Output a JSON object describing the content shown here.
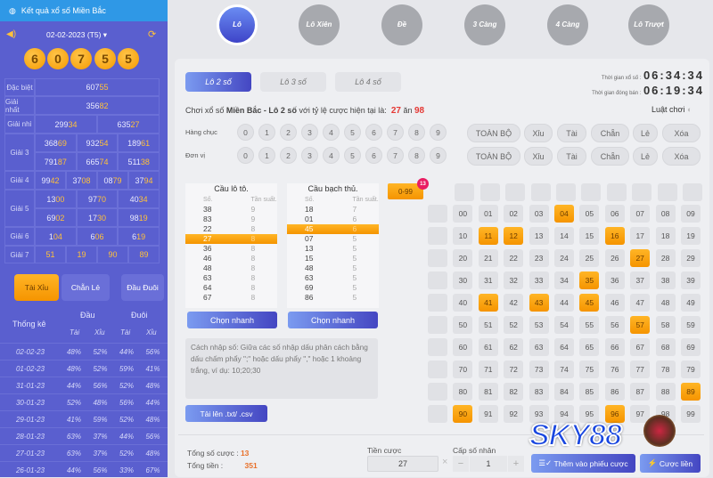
{
  "sidebar": {
    "title": "Kết quả xổ số Miền Bắc",
    "date": "02-02-2023 (T5)",
    "balls": [
      "6",
      "0",
      "7",
      "5",
      "5"
    ],
    "prizes": [
      {
        "label": "Đặc biệt",
        "rows": [
          [
            "60755"
          ]
        ]
      },
      {
        "label": "Giải nhất",
        "rows": [
          [
            "35682"
          ]
        ]
      },
      {
        "label": "Giải nhì",
        "rows": [
          [
            "29934",
            "63527"
          ]
        ]
      },
      {
        "label": "Giải 3",
        "rows": [
          [
            "36869",
            "93254",
            "18961"
          ],
          [
            "79187",
            "66574",
            "51138"
          ]
        ]
      },
      {
        "label": "Giải 4",
        "rows": [
          [
            "9942",
            "3708",
            "0879",
            "3794"
          ]
        ]
      },
      {
        "label": "Giải 5",
        "rows": [
          [
            "1300",
            "9770",
            "4034"
          ],
          [
            "6902",
            "1730",
            "9819"
          ]
        ]
      },
      {
        "label": "Giải 6",
        "rows": [
          [
            "104",
            "606",
            "619"
          ]
        ]
      },
      {
        "label": "Giải 7",
        "rows": [
          [
            "51",
            "19",
            "90",
            "89"
          ]
        ]
      }
    ],
    "tabs": [
      "Tài Xỉu",
      "Chẵn Lẻ",
      "Đầu Đuôi"
    ],
    "stats": {
      "title": "Thống kê",
      "head": "Đầu",
      "tail": "Đuôi",
      "tai": "Tài",
      "xiu": "Xỉu",
      "rows": [
        [
          "02-02-23",
          "48%",
          "52%",
          "44%",
          "56%"
        ],
        [
          "01-02-23",
          "48%",
          "52%",
          "59%",
          "41%"
        ],
        [
          "31-01-23",
          "44%",
          "56%",
          "52%",
          "48%"
        ],
        [
          "30-01-23",
          "52%",
          "48%",
          "56%",
          "44%"
        ],
        [
          "29-01-23",
          "41%",
          "59%",
          "52%",
          "48%"
        ],
        [
          "28-01-23",
          "63%",
          "37%",
          "44%",
          "56%"
        ],
        [
          "27-01-23",
          "63%",
          "37%",
          "52%",
          "48%"
        ],
        [
          "26-01-23",
          "44%",
          "56%",
          "33%",
          "67%"
        ]
      ]
    }
  },
  "nav": [
    "Lô",
    "Lô Xiên",
    "Đề",
    "3 Càng",
    "4 Càng",
    "Lô Trượt"
  ],
  "lo_tabs": [
    "Lô 2 số",
    "Lô 3 số",
    "Lô 4 số"
  ],
  "timers": {
    "draw_label": "Thời gian xổ số :",
    "draw": "06:34:34",
    "close_label": "Thời gian đóng bán :",
    "close": "06:19:34"
  },
  "intro": {
    "pre": "Chơi xổ số ",
    "bold": "Miền Bắc - Lô 2 số",
    "post": " với tỷ lệ cược hiện tại là:",
    "rate_a": "27",
    "mid": "ăn",
    "rate_b": "98"
  },
  "rules": "Luật chơi",
  "digit_rows": [
    "Hàng chục",
    "Đơn vị"
  ],
  "digits": [
    "0",
    "1",
    "2",
    "3",
    "4",
    "5",
    "6",
    "7",
    "8",
    "9"
  ],
  "quick": [
    "TOÀN BỘ",
    "Xỉu",
    "Tài",
    "Chẵn",
    "Lẻ",
    "Xóa"
  ],
  "cau_lo": {
    "title": "Cầu lô tô.",
    "col_a": "Số.",
    "col_b": "Tần suất.",
    "rows": [
      [
        "38",
        "9"
      ],
      [
        "83",
        "9"
      ],
      [
        "22",
        "8"
      ],
      [
        "27",
        "8"
      ],
      [
        "36",
        "8"
      ],
      [
        "46",
        "8"
      ],
      [
        "48",
        "8"
      ],
      [
        "63",
        "8"
      ],
      [
        "64",
        "8"
      ],
      [
        "67",
        "8"
      ]
    ],
    "highlight": "27"
  },
  "cau_bach": {
    "title": "Cầu bạch thủ.",
    "col_a": "Số.",
    "col_b": "Tần suất.",
    "rows": [
      [
        "18",
        "7"
      ],
      [
        "01",
        "6"
      ],
      [
        "45",
        "6"
      ],
      [
        "07",
        "5"
      ],
      [
        "13",
        "5"
      ],
      [
        "15",
        "5"
      ],
      [
        "48",
        "5"
      ],
      [
        "63",
        "5"
      ],
      [
        "69",
        "5"
      ],
      [
        "86",
        "5"
      ]
    ],
    "highlight": "45"
  },
  "quick_pick": "Chọn nhanh",
  "input_hint": "Cách nhập số: Giữa các số nhập dấu phân cách bằng dấu chấm phẩy \";\" hoặc dấu phẩy \",\" hoặc 1 khoảng trắng, ví dụ: 10;20;30",
  "upload": "Tải lên .txt/ .csv",
  "range": {
    "label": "0-99",
    "badge": "13"
  },
  "selected": [
    "04",
    "11",
    "12",
    "16",
    "27",
    "35",
    "41",
    "43",
    "45",
    "57",
    "89",
    "90",
    "96"
  ],
  "footer": {
    "count_label": "Tổng số cược :",
    "count": "13",
    "total_label": "Tổng tiền :",
    "total": "351",
    "bet_label": "Tiền cược",
    "bet": "27",
    "mult_label": "Cấp số nhân",
    "mult": "1",
    "minus": "−",
    "plus": "+",
    "times": "×",
    "add": "Thêm vào phiếu cược",
    "bet_now": "Cược liền"
  },
  "watermark": "SKY88",
  "colors": {
    "accent": "#f59a00",
    "sidebar": "#5a5fcf",
    "header": "#2f98e6",
    "rate": "#e53935"
  }
}
